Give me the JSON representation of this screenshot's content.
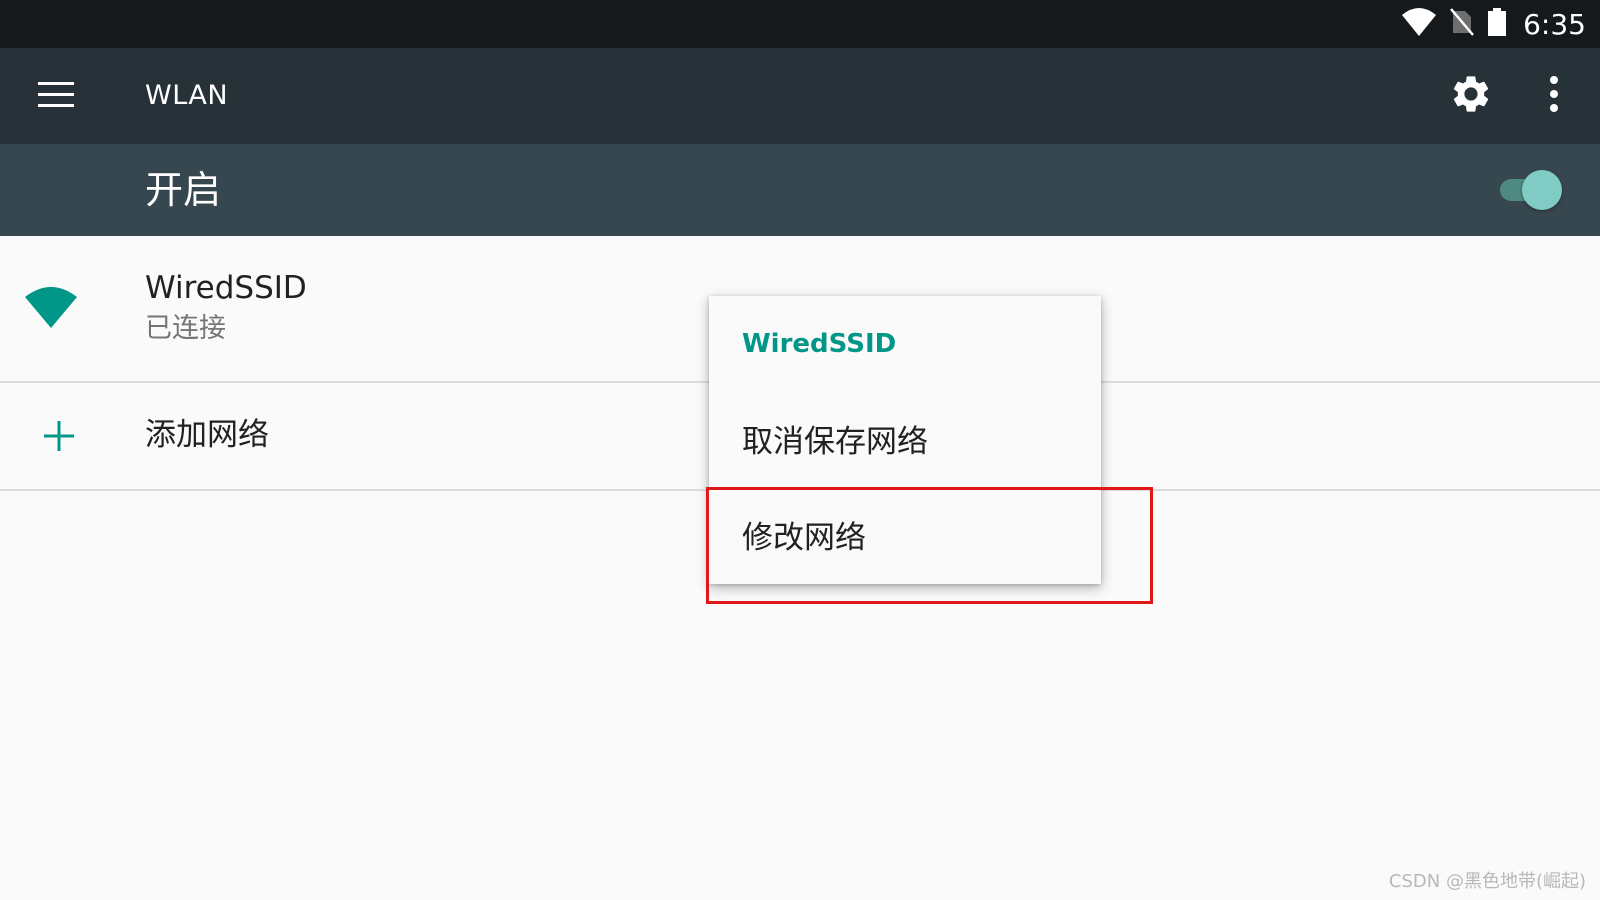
{
  "status_bar": {
    "time": "6:35",
    "icons": [
      "wifi-signal-icon",
      "no-sim-icon",
      "battery-icon"
    ]
  },
  "app_bar": {
    "title": "WLAN",
    "icons": [
      "menu-icon",
      "settings-icon",
      "overflow-menu-icon"
    ]
  },
  "wlan_switch": {
    "label": "开启",
    "state": "on",
    "color": "#80cbc4"
  },
  "networks": [
    {
      "name": "WiredSSID",
      "status": "已连接",
      "icon": "wifi-full-icon"
    }
  ],
  "add_network": {
    "label": "添加网络",
    "icon": "plus-icon"
  },
  "context_menu": {
    "title": "WiredSSID",
    "items": [
      {
        "label": "取消保存网络"
      },
      {
        "label": "修改网络"
      }
    ],
    "highlighted_item": "修改网络"
  },
  "colors": {
    "status_bar": "#15191c",
    "app_bar": "#263238",
    "switch_bar": "#37474f",
    "accent": "#009688",
    "highlight": "#e01818"
  },
  "watermark": "CSDN @黑色地带(崛起)"
}
